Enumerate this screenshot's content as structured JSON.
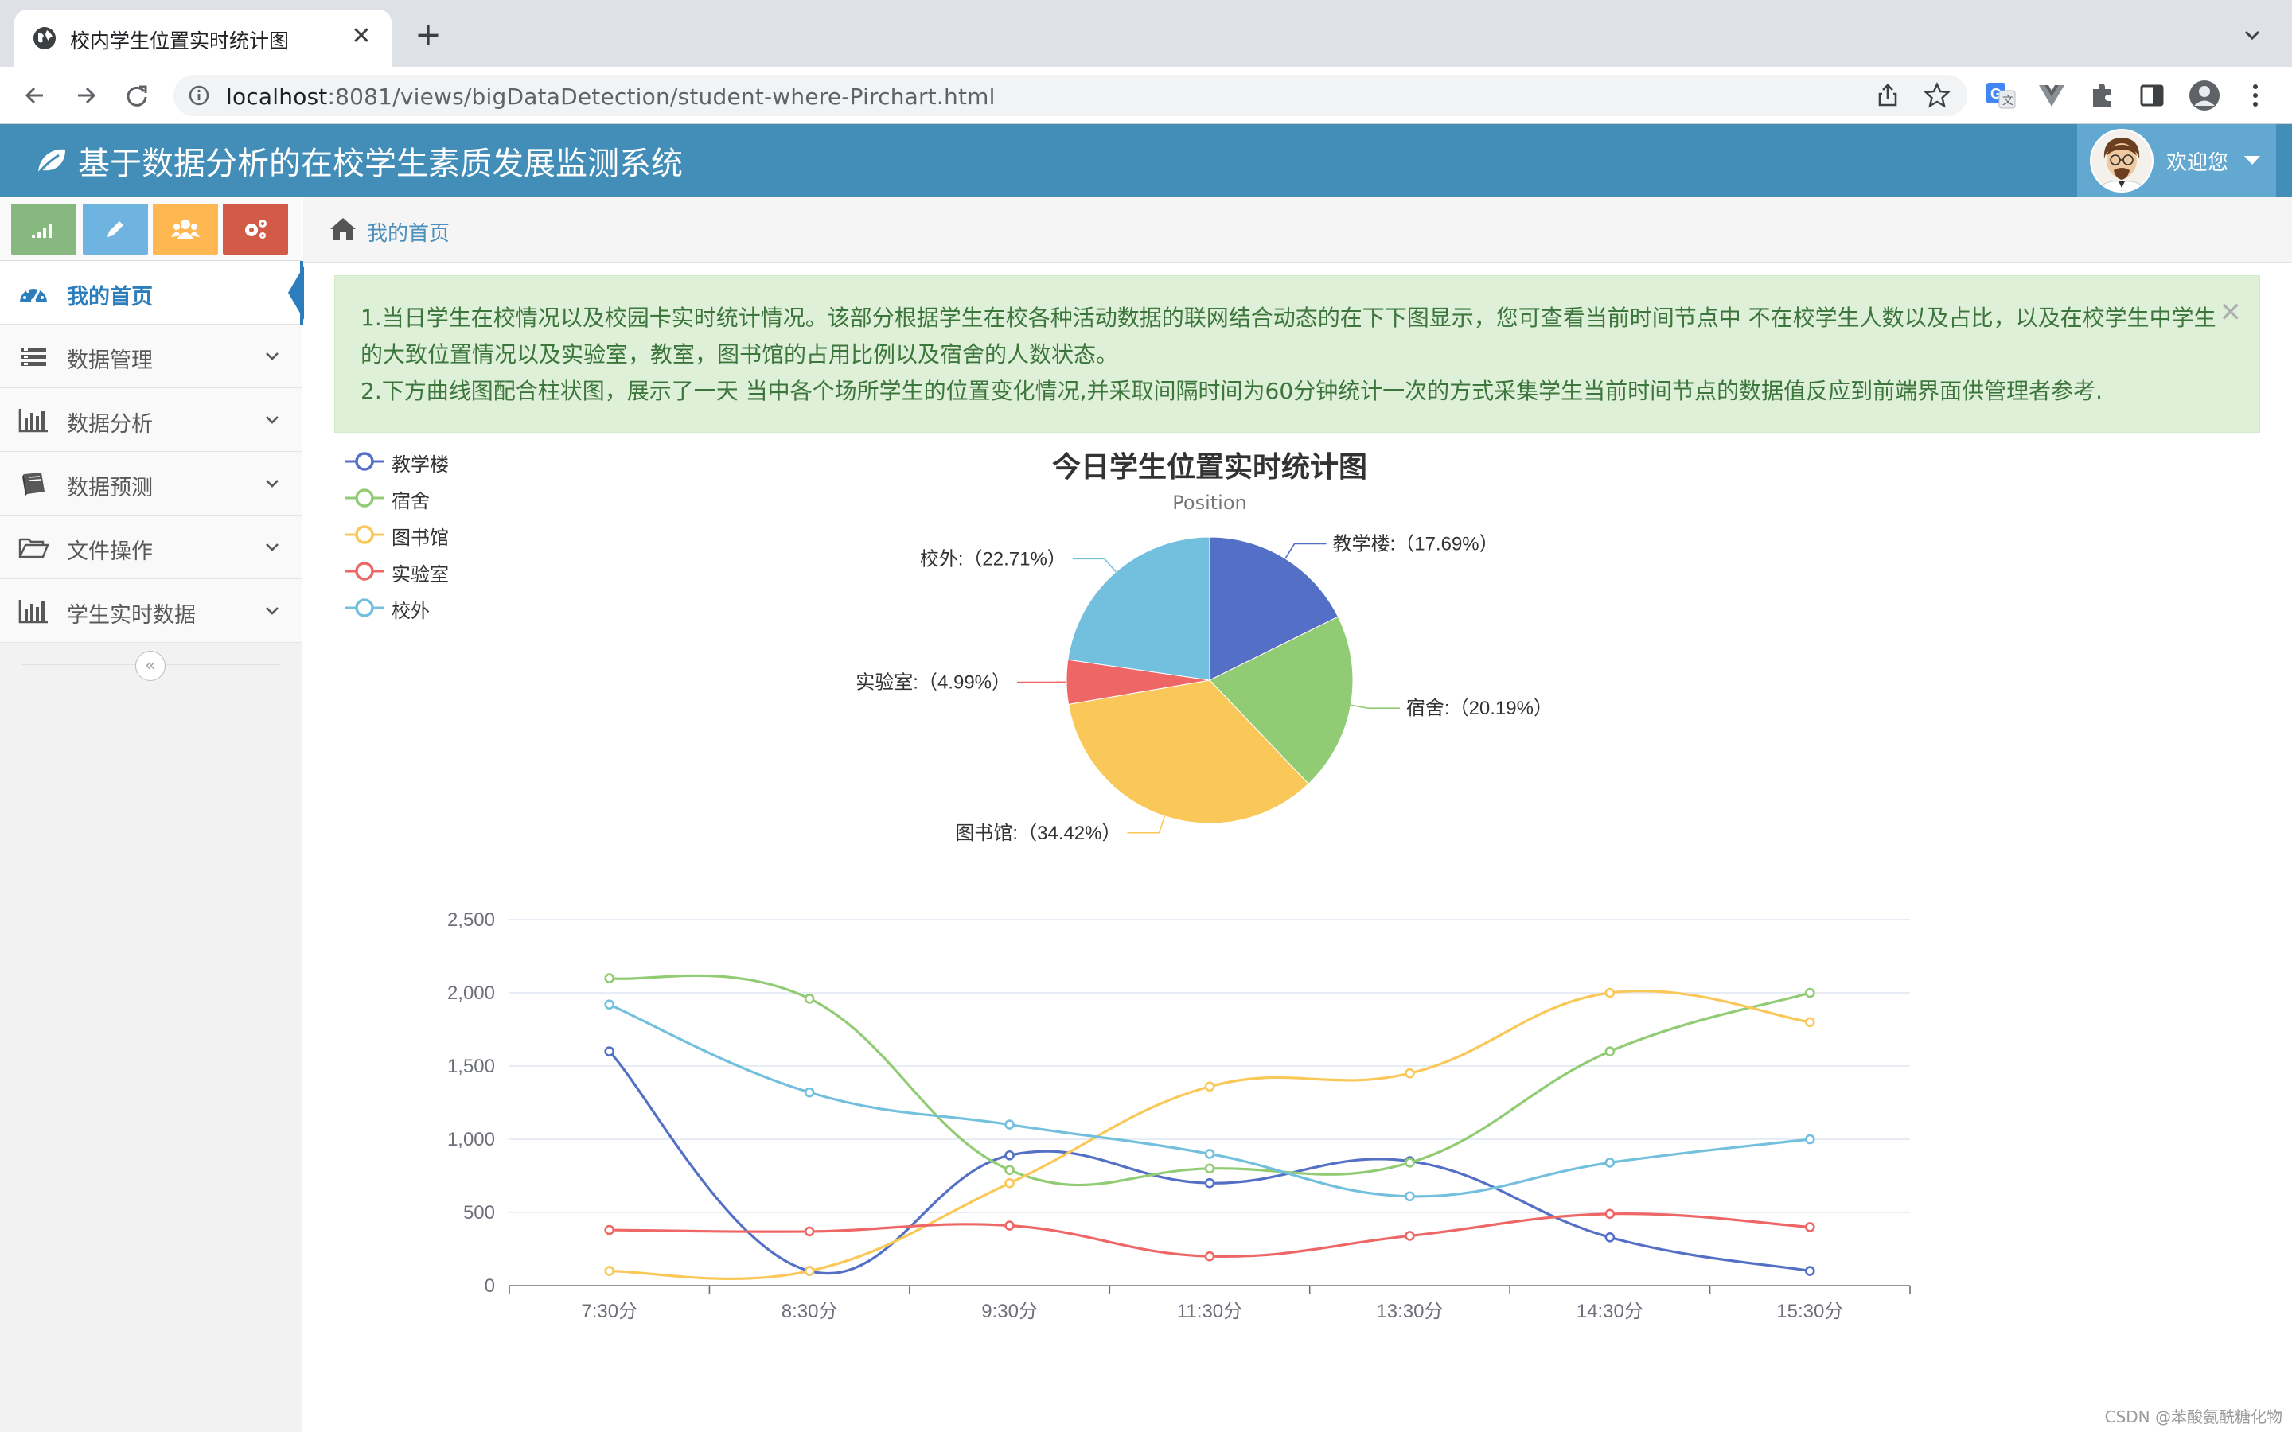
{
  "browser": {
    "tab_title": "校内学生位置实时统计图",
    "url_host": "localhost",
    "url_rest": ":8081/views/bigDataDetection/student-where-Pirchart.html"
  },
  "header": {
    "title": "基于数据分析的在校学生素质发展监测系统",
    "welcome": "欢迎您"
  },
  "sidebar": {
    "items": [
      {
        "label": "我的首页",
        "icon": "dashboard-icon",
        "active": true
      },
      {
        "label": "数据管理",
        "icon": "list-icon"
      },
      {
        "label": "数据分析",
        "icon": "bar-chart-icon"
      },
      {
        "label": "数据预测",
        "icon": "book-icon"
      },
      {
        "label": "文件操作",
        "icon": "folder-open-icon"
      },
      {
        "label": "学生实时数据",
        "icon": "bar-chart-icon"
      }
    ],
    "shortcut_colors": [
      "#87b87f",
      "#6fb3e0",
      "#ffb752",
      "#d15b47"
    ]
  },
  "breadcrumb": {
    "home": "我的首页"
  },
  "alert": {
    "line1": "1.当日学生在校情况以及校园卡实时统计情况。该部分根据学生在校各种活动数据的联网结合动态的在下下图显示，您可查看当前时间节点中 不在校学生人数以及占比，以及在校学生中学生的大致位置情况以及实验室，教室，图书馆的占用比例以及宿舍的人数状态。",
    "line2": "2.下方曲线图配合柱状图，展示了一天 当中各个场所学生的位置变化情况,并采取间隔时间为60分钟统计一次的方式采集学生当前时间节点的数据值反应到前端界面供管理者参考."
  },
  "chart_data": [
    {
      "type": "pie",
      "title": "今日学生位置实时统计图",
      "subtitle": "Position",
      "slices": [
        {
          "name": "教学楼",
          "percent": 17.69,
          "label": "教学楼:（17.69%）",
          "color": "#5470c6"
        },
        {
          "name": "宿舍",
          "percent": 20.19,
          "label": "宿舍:（20.19%）",
          "color": "#91cc75"
        },
        {
          "name": "图书馆",
          "percent": 34.42,
          "label": "图书馆:（34.42%）",
          "color": "#fac858"
        },
        {
          "name": "实验室",
          "percent": 4.99,
          "label": "实验室:（4.99%）",
          "color": "#ee6666"
        },
        {
          "name": "校外",
          "percent": 22.71,
          "label": "校外:（22.71%）",
          "color": "#73c0de"
        }
      ],
      "legend": [
        "教学楼",
        "宿舍",
        "图书馆",
        "实验室",
        "校外"
      ],
      "legend_position": "top-left"
    },
    {
      "type": "line",
      "smooth": true,
      "categories": [
        "7:30分",
        "8:30分",
        "9:30分",
        "11:30分",
        "13:30分",
        "14:30分",
        "15:30分"
      ],
      "ylim": [
        0,
        2500
      ],
      "yticks": [
        "0",
        "500",
        "1,000",
        "1,500",
        "2,000",
        "2,500"
      ],
      "grid": true,
      "series": [
        {
          "name": "教学楼",
          "color": "#5470c6",
          "values": [
            1600,
            100,
            890,
            700,
            850,
            330,
            100
          ]
        },
        {
          "name": "宿舍",
          "color": "#91cc75",
          "values": [
            2100,
            1960,
            790,
            800,
            840,
            1600,
            2000
          ]
        },
        {
          "name": "图书馆",
          "color": "#fac858",
          "values": [
            100,
            100,
            700,
            1360,
            1450,
            2000,
            1800
          ]
        },
        {
          "name": "实验室",
          "color": "#ee6666",
          "values": [
            380,
            370,
            410,
            200,
            340,
            490,
            400
          ]
        },
        {
          "name": "校外",
          "color": "#73c0de",
          "values": [
            1920,
            1320,
            1100,
            900,
            610,
            840,
            1000
          ]
        }
      ]
    }
  ],
  "watermark": "CSDN @苯酸氨酰糖化物"
}
